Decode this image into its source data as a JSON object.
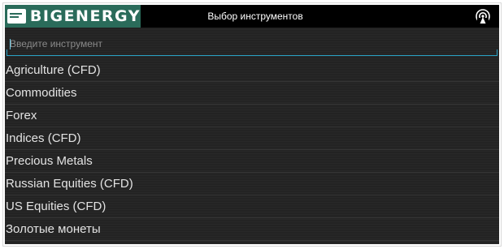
{
  "app": {
    "logo_text": "BIGENERGY",
    "title": "Выбор инструментов",
    "brand_color": "#2a6b5a",
    "accent_color": "#2aa3c6",
    "menu_icon": "broadcast-icon"
  },
  "search": {
    "value": "",
    "placeholder": "Введите инструмент"
  },
  "instruments": [
    "Agriculture (CFD)",
    "Commodities",
    "Forex",
    "Indices (CFD)",
    "Precious Metals",
    "Russian Equities (CFD)",
    "US Equities (CFD)",
    "Золотые монеты"
  ]
}
